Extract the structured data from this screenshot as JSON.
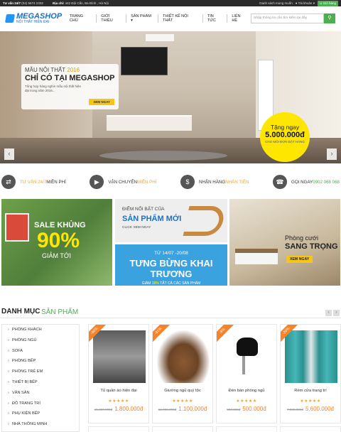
{
  "topbar": {
    "hotline_label": "Tư vấn 24/7",
    "hotline_number": "(04) 6674 2332",
    "address_label": "Địa chỉ:",
    "address": "442 Đội Cấn, Ba Đình , Hà Nội",
    "wishlist": "Danh sách mong muốn",
    "account": "Tài khoản",
    "cart": "Giỏ hàng"
  },
  "header": {
    "logo_name": "MEGASHOP",
    "logo_tagline": "NỘI THẤT HIỆN ĐẠI",
    "nav": [
      "TRANG CHỦ",
      "GIỚI THIỆU",
      "SẢN PHẨM ▾",
      "THIẾT KẾ NỘI THẤT",
      "TIN TỨC",
      "LIÊN HỆ"
    ],
    "search_placeholder": "Nhập thông tin cần tìm kiếm tại đây"
  },
  "slider": {
    "kicker": "MẪU NỘI THẤT",
    "year": "2016",
    "headline": "CHỈ CÓ TẠI MEGASHOP",
    "desc": "Tổng hợp hàng nghìn mẫu nội thất hiện đại trong năm 2016...",
    "cta": "XEM NGAY",
    "badge_top": "Tặng ngay",
    "badge_amount": "5.000.000đ",
    "badge_note": "CHO MỖI ĐƠN ĐẶT HÀNG",
    "prev": "‹",
    "next": "›"
  },
  "services": [
    {
      "icon": "⇄",
      "pre": "",
      "hl": "TƯ VẤN 24/7",
      "post": " MIỄN PHÍ"
    },
    {
      "icon": "▶",
      "pre": "VẬN CHUYỂN ",
      "hl": "MIỄN PHÍ",
      "post": ""
    },
    {
      "icon": "$",
      "pre": "NHẬN HÀNG ",
      "hl": "NHẬN TIỀN",
      "post": ""
    },
    {
      "icon": "☎",
      "pre": "GỌI NGAY ",
      "hl": "0902 068 068",
      "post": ""
    }
  ],
  "banners": {
    "sale_title": "SALE KHỦNG",
    "sale_pct": "90%",
    "sale_sub": "GIẢM TỚI",
    "new_kicker": "ĐIỂM NỔI BẬT CỦA",
    "new_title": "SẢN PHẨM MỚI",
    "new_cta": "CLICK XEM NGAY",
    "open_dates": "TỪ 14/07 -20/08",
    "open_title": "TƯNG BỪNG KHAI TRƯƠNG",
    "open_sub_pre": "GIẢM ",
    "open_sub_pct": "10%",
    "open_sub_post": " TẤT CẢ CÁC SẢN PHẨM",
    "room_line1": "Phòng cưới",
    "room_line2": "SANG TRỌNG",
    "room_cta": "XEM NGAY"
  },
  "section": {
    "title": "DANH MỤC",
    "subtitle": "SẢN PHẨM",
    "prev": "‹",
    "next": "›"
  },
  "categories": [
    "PHÒNG KHÁCH",
    "PHÒNG NGỦ",
    "SOFA",
    "PHÒNG BẾP",
    "PHÒNG TRẺ EM",
    "THIẾT BỊ BẾP",
    "VĂN SẢN",
    "ĐỒ TRANG TRÍ",
    "PHỤ KIỆN BẾP",
    "NHÀ THÔNG MINH"
  ],
  "products": [
    {
      "tag": "-90%",
      "name": "Tủ quần áo hiện đại",
      "stars": "★★★★★",
      "old": "15.000.000đ",
      "price": "1.800.000đ"
    },
    {
      "tag": "-91%",
      "name": "Giường ngủ quý tộc",
      "stars": "★★★★★",
      "old": "12.000.000đ",
      "price": "1.100.000đ"
    },
    {
      "tag": "-9%",
      "name": "Đèn bàn phòng ngủ",
      "stars": "★★★★★",
      "old": "550.000đ",
      "price": "500.000đ"
    },
    {
      "tag": "-20%",
      "name": "Rèm cửa trang trí",
      "stars": "★★★★★",
      "old": "7.000.000đ",
      "price": "5.600.000đ"
    }
  ]
}
